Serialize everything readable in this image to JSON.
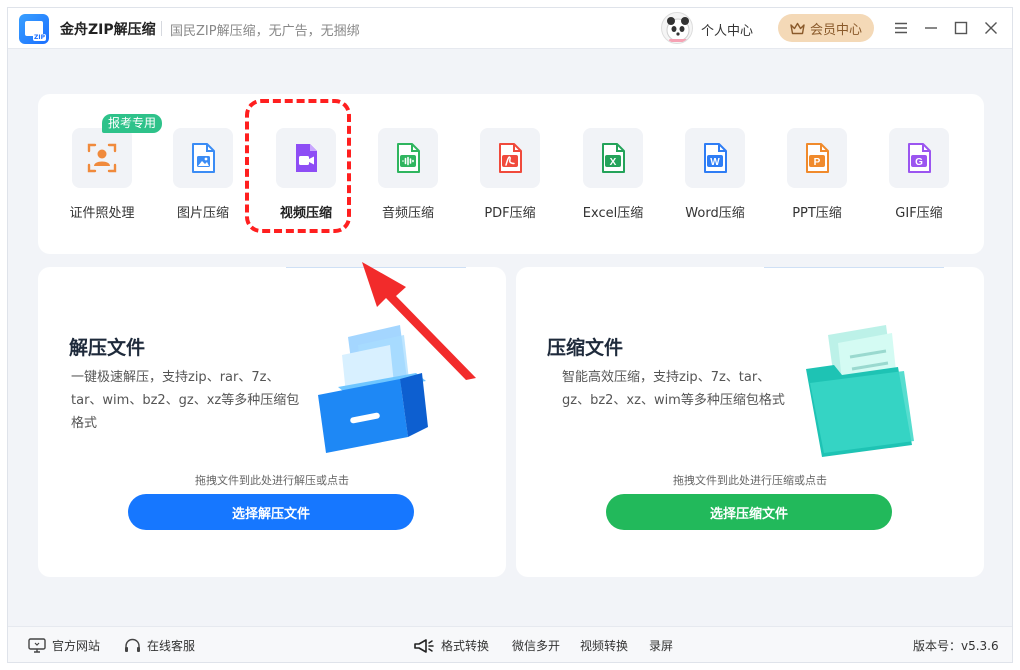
{
  "app": {
    "title": "金舟ZIP解压缩",
    "slogan": "国民ZIP解压缩，无广告，无捆绑",
    "logo_text": "ZIP",
    "user_center": "个人中心",
    "vip_center": "会员中心"
  },
  "colors": {
    "brand_blue": "#1677ff",
    "green": "#22b95b",
    "highlight_red": "#ff1f1f",
    "badge_green": "#2ec28a"
  },
  "tools": {
    "badge": "报考专用",
    "items": [
      {
        "label": "证件照处理",
        "icon": "id-photo-icon",
        "color": "#f08a3c"
      },
      {
        "label": "图片压缩",
        "icon": "image-file-icon",
        "color": "#3b8cf5"
      },
      {
        "label": "视频压缩",
        "icon": "video-file-icon",
        "color": "#8e4df5"
      },
      {
        "label": "音频压缩",
        "icon": "audio-file-icon",
        "color": "#2fb55f"
      },
      {
        "label": "PDF压缩",
        "icon": "pdf-file-icon",
        "color": "#f04a3c",
        "letter": ""
      },
      {
        "label": "Excel压缩",
        "icon": "excel-file-icon",
        "color": "#24a35a",
        "letter": "X"
      },
      {
        "label": "Word压缩",
        "icon": "word-file-icon",
        "color": "#2f7df5",
        "letter": "W"
      },
      {
        "label": "PPT压缩",
        "icon": "ppt-file-icon",
        "color": "#f08a2c",
        "letter": "P"
      },
      {
        "label": "GIF压缩",
        "icon": "gif-file-icon",
        "color": "#9b55f0",
        "letter": "G"
      }
    ]
  },
  "unzip": {
    "title": "解压文件",
    "desc": "一键极速解压，支持zip、rar、7z、tar、wim、bz2、gz、xz等多种压缩包格式",
    "hint": "拖拽文件到此处进行解压或点击",
    "button": "选择解压文件"
  },
  "zip": {
    "title": "压缩文件",
    "desc": "智能高效压缩，支持zip、7z、tar、gz、bz2、xz、wim等多种压缩包格式",
    "hint": "拖拽文件到此处进行压缩或点击",
    "button": "选择压缩文件"
  },
  "statusbar": {
    "website": "官方网站",
    "service": "在线客服",
    "format_convert": "格式转换",
    "wechat_multi": "微信多开",
    "video_convert": "视频转换",
    "record": "录屏",
    "version": "版本号：v5.3.6"
  }
}
